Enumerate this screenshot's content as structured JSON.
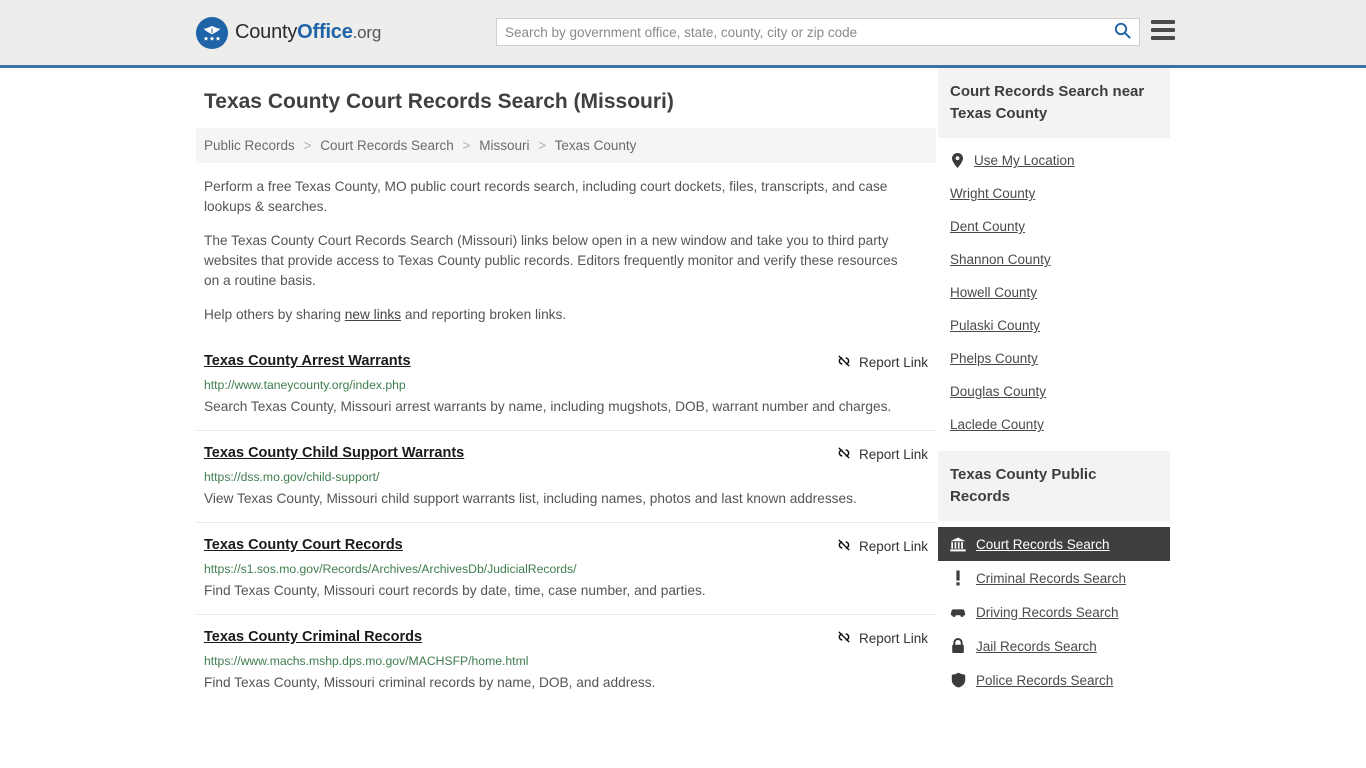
{
  "header": {
    "brand": {
      "part1": "County",
      "part2": "Office",
      "part3": ".org",
      "logo_icon": "eagle-stars-logo-icon"
    },
    "search": {
      "placeholder": "Search by government office, state, county, city or zip code",
      "value": "",
      "search_icon": "search-icon"
    },
    "menu_icon": "hamburger-menu-icon",
    "accent_color": "#3b72a4"
  },
  "main": {
    "title": "Texas County Court Records Search (Missouri)",
    "breadcrumb": [
      {
        "label": "Public Records"
      },
      {
        "label": "Court Records Search"
      },
      {
        "label": "Missouri"
      },
      {
        "label": "Texas County"
      }
    ],
    "breadcrumb_separator": ">",
    "intro": [
      "Perform a free Texas County, MO public court records search, including court dockets, files, transcripts, and case lookups & searches.",
      "The Texas County Court Records Search (Missouri) links below open in a new window and take you to third party websites that provide access to Texas County public records. Editors frequently monitor and verify these resources on a routine basis."
    ],
    "help_text_before": "Help others by sharing ",
    "help_link": "new links",
    "help_text_after": " and reporting broken links.",
    "report_link_label": "Report Link",
    "report_link_icon": "broken-link-icon",
    "results": [
      {
        "title": "Texas County Arrest Warrants",
        "url": "http://www.taneycounty.org/index.php",
        "description": "Search Texas County, Missouri arrest warrants by name, including mugshots, DOB, warrant number and charges."
      },
      {
        "title": "Texas County Child Support Warrants",
        "url": "https://dss.mo.gov/child-support/",
        "description": "View Texas County, Missouri child support warrants list, including names, photos and last known addresses."
      },
      {
        "title": "Texas County Court Records",
        "url": "https://s1.sos.mo.gov/Records/Archives/ArchivesDb/JudicialRecords/",
        "description": "Find Texas County, Missouri court records by date, time, case number, and parties."
      },
      {
        "title": "Texas County Criminal Records",
        "url": "https://www.machs.mshp.dps.mo.gov/MACHSFP/home.html",
        "description": "Find Texas County, Missouri criminal records by name, DOB, and address."
      }
    ]
  },
  "sidebar": {
    "nearby": {
      "title": "Court Records Search near Texas County",
      "items": [
        {
          "label": "Use My Location",
          "icon": "map-pin-icon"
        },
        {
          "label": "Wright County",
          "icon": ""
        },
        {
          "label": "Dent County",
          "icon": ""
        },
        {
          "label": "Shannon County",
          "icon": ""
        },
        {
          "label": "Howell County",
          "icon": ""
        },
        {
          "label": "Pulaski County",
          "icon": ""
        },
        {
          "label": "Phelps County",
          "icon": ""
        },
        {
          "label": "Douglas County",
          "icon": ""
        },
        {
          "label": "Laclede County",
          "icon": ""
        }
      ]
    },
    "public_records": {
      "title": "Texas County Public Records",
      "active_bg": "#3f3f3f",
      "items": [
        {
          "label": "Court Records Search",
          "icon": "courthouse-icon",
          "active": true
        },
        {
          "label": "Criminal Records Search",
          "icon": "exclamation-icon",
          "active": false
        },
        {
          "label": "Driving Records Search",
          "icon": "car-icon",
          "active": false
        },
        {
          "label": "Jail Records Search",
          "icon": "lock-icon",
          "active": false
        },
        {
          "label": "Police Records Search",
          "icon": "police-badge-icon",
          "active": false
        }
      ]
    }
  }
}
